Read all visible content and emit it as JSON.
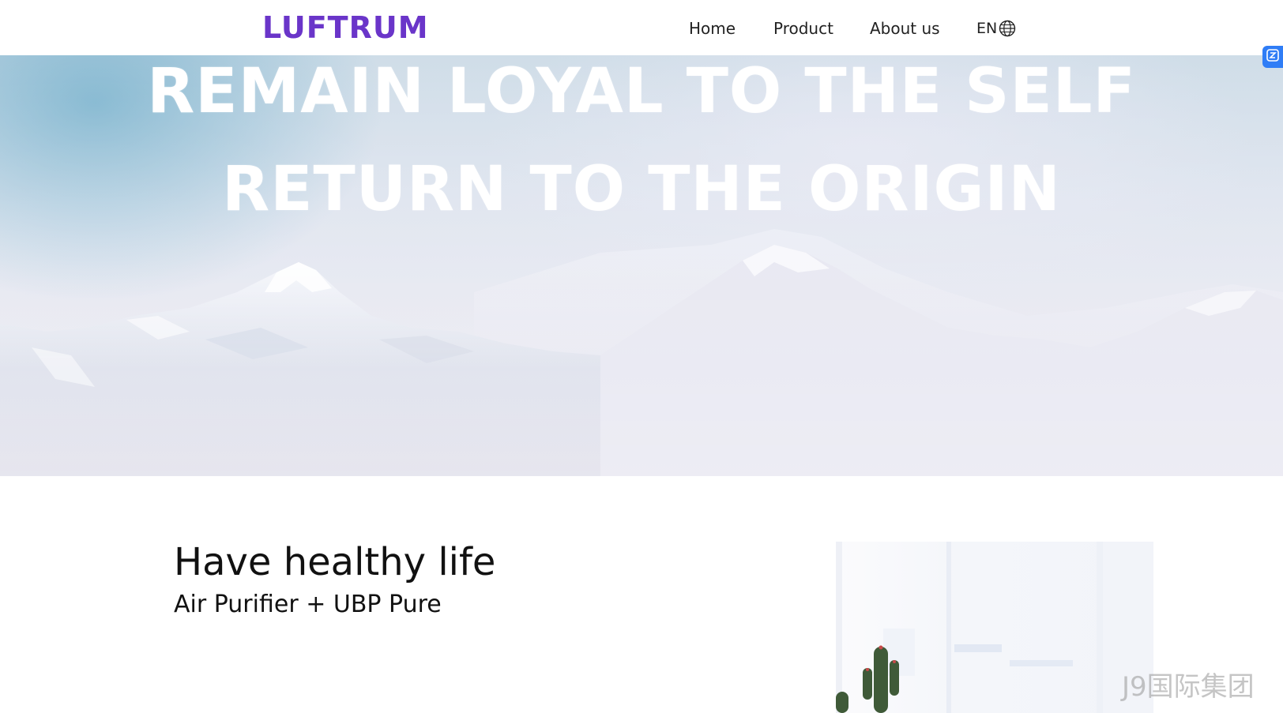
{
  "header": {
    "logo": "LUFTRUM",
    "nav": [
      "Home",
      "Product",
      "About us"
    ],
    "lang": "EN",
    "lang_icon": "globe-icon"
  },
  "hero": {
    "line1": "REMAIN LOYAL TO THE SELF",
    "line2": "RETURN TO THE ORIGIN"
  },
  "feature": {
    "title": "Have healthy life",
    "subtitle": "Air Purifier + UBP Pure"
  },
  "watermark": "J9国际集团",
  "side_widget_icon": "translate-icon",
  "colors": {
    "brand": "#6a35c9",
    "widget": "#2f7df6"
  }
}
